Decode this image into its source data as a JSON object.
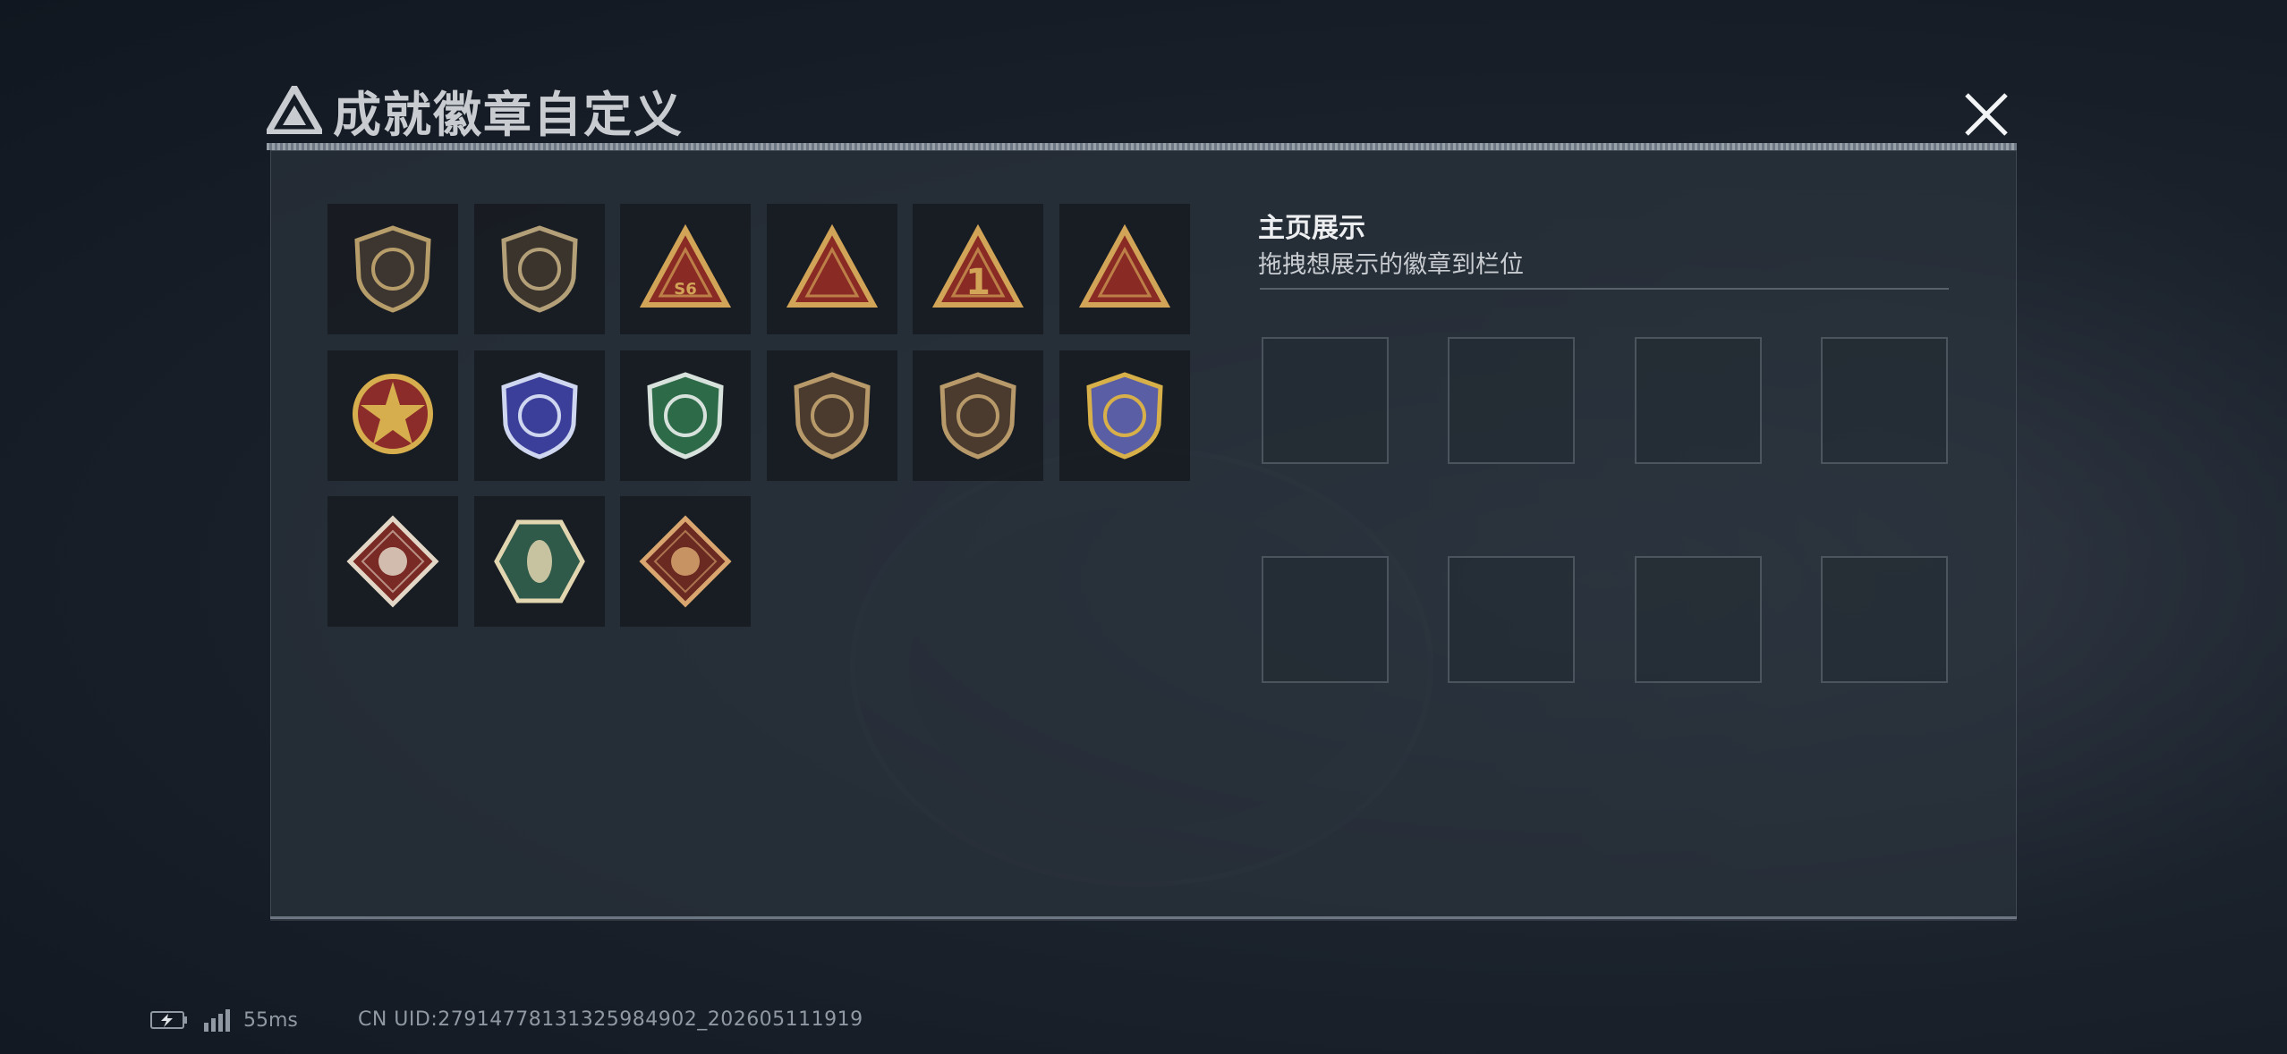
{
  "header": {
    "title": "成就徽章自定义",
    "logo_icon": "triangle-logo-icon",
    "close_icon": "close-icon"
  },
  "badges": [
    {
      "name": "shield-triangle-badge",
      "style": "shield",
      "primary": "#b79d6a",
      "secondary": "#3c3530"
    },
    {
      "name": "helicopter-shield-badge",
      "style": "shield",
      "primary": "#b4a078",
      "secondary": "#3b342d"
    },
    {
      "name": "s6-triangle-badge",
      "style": "triangle",
      "primary": "#d2a457",
      "secondary": "#8a2a24",
      "label": "S6"
    },
    {
      "name": "boat-triangle-badge",
      "style": "triangle",
      "primary": "#d2a457",
      "secondary": "#8a2a24"
    },
    {
      "name": "number-one-triangle-badge",
      "style": "triangle",
      "primary": "#d2a457",
      "secondary": "#8a2a24",
      "label": "1"
    },
    {
      "name": "squad-triangle-badge",
      "style": "triangle",
      "primary": "#d2a457",
      "secondary": "#8a2a24"
    },
    {
      "name": "star-compass-badge",
      "style": "round",
      "primary": "#d7ae4e",
      "secondary": "#8c2c2a"
    },
    {
      "name": "blue-wings-badge",
      "style": "shield",
      "primary": "#cfd6f0",
      "secondary": "#3b3f9a"
    },
    {
      "name": "green-gem-badge",
      "style": "shield",
      "primary": "#d8e2dc",
      "secondary": "#2c6a48"
    },
    {
      "name": "rifle-crosshair-badge",
      "style": "shield",
      "primary": "#b89a6a",
      "secondary": "#4a3b2e"
    },
    {
      "name": "smg-crosshair-badge",
      "style": "shield",
      "primary": "#b89a6a",
      "secondary": "#4a3b2e"
    },
    {
      "name": "sniper-wreath-badge",
      "style": "shield",
      "primary": "#d8b04a",
      "secondary": "#5a5fa5"
    },
    {
      "name": "wolf-diamond-badge",
      "style": "diamond",
      "primary": "#e2d6c6",
      "secondary": "#7a2a24"
    },
    {
      "name": "hornet-hexagon-badge",
      "style": "hexagon",
      "primary": "#e2d6b0",
      "secondary": "#2f5a4a"
    },
    {
      "name": "dragon-diamond-badge",
      "style": "diamond",
      "primary": "#d8a66e",
      "secondary": "#6a2a22"
    }
  ],
  "display": {
    "title": "主页展示",
    "subtitle": "拖拽想展示的徽章到栏位",
    "slot_count": 8
  },
  "status_bar": {
    "latency": "55ms",
    "uid": "CN UID:27914778131325984902_202605111919",
    "battery_icon": "battery-charging-icon",
    "signal_icon": "signal-icon"
  }
}
